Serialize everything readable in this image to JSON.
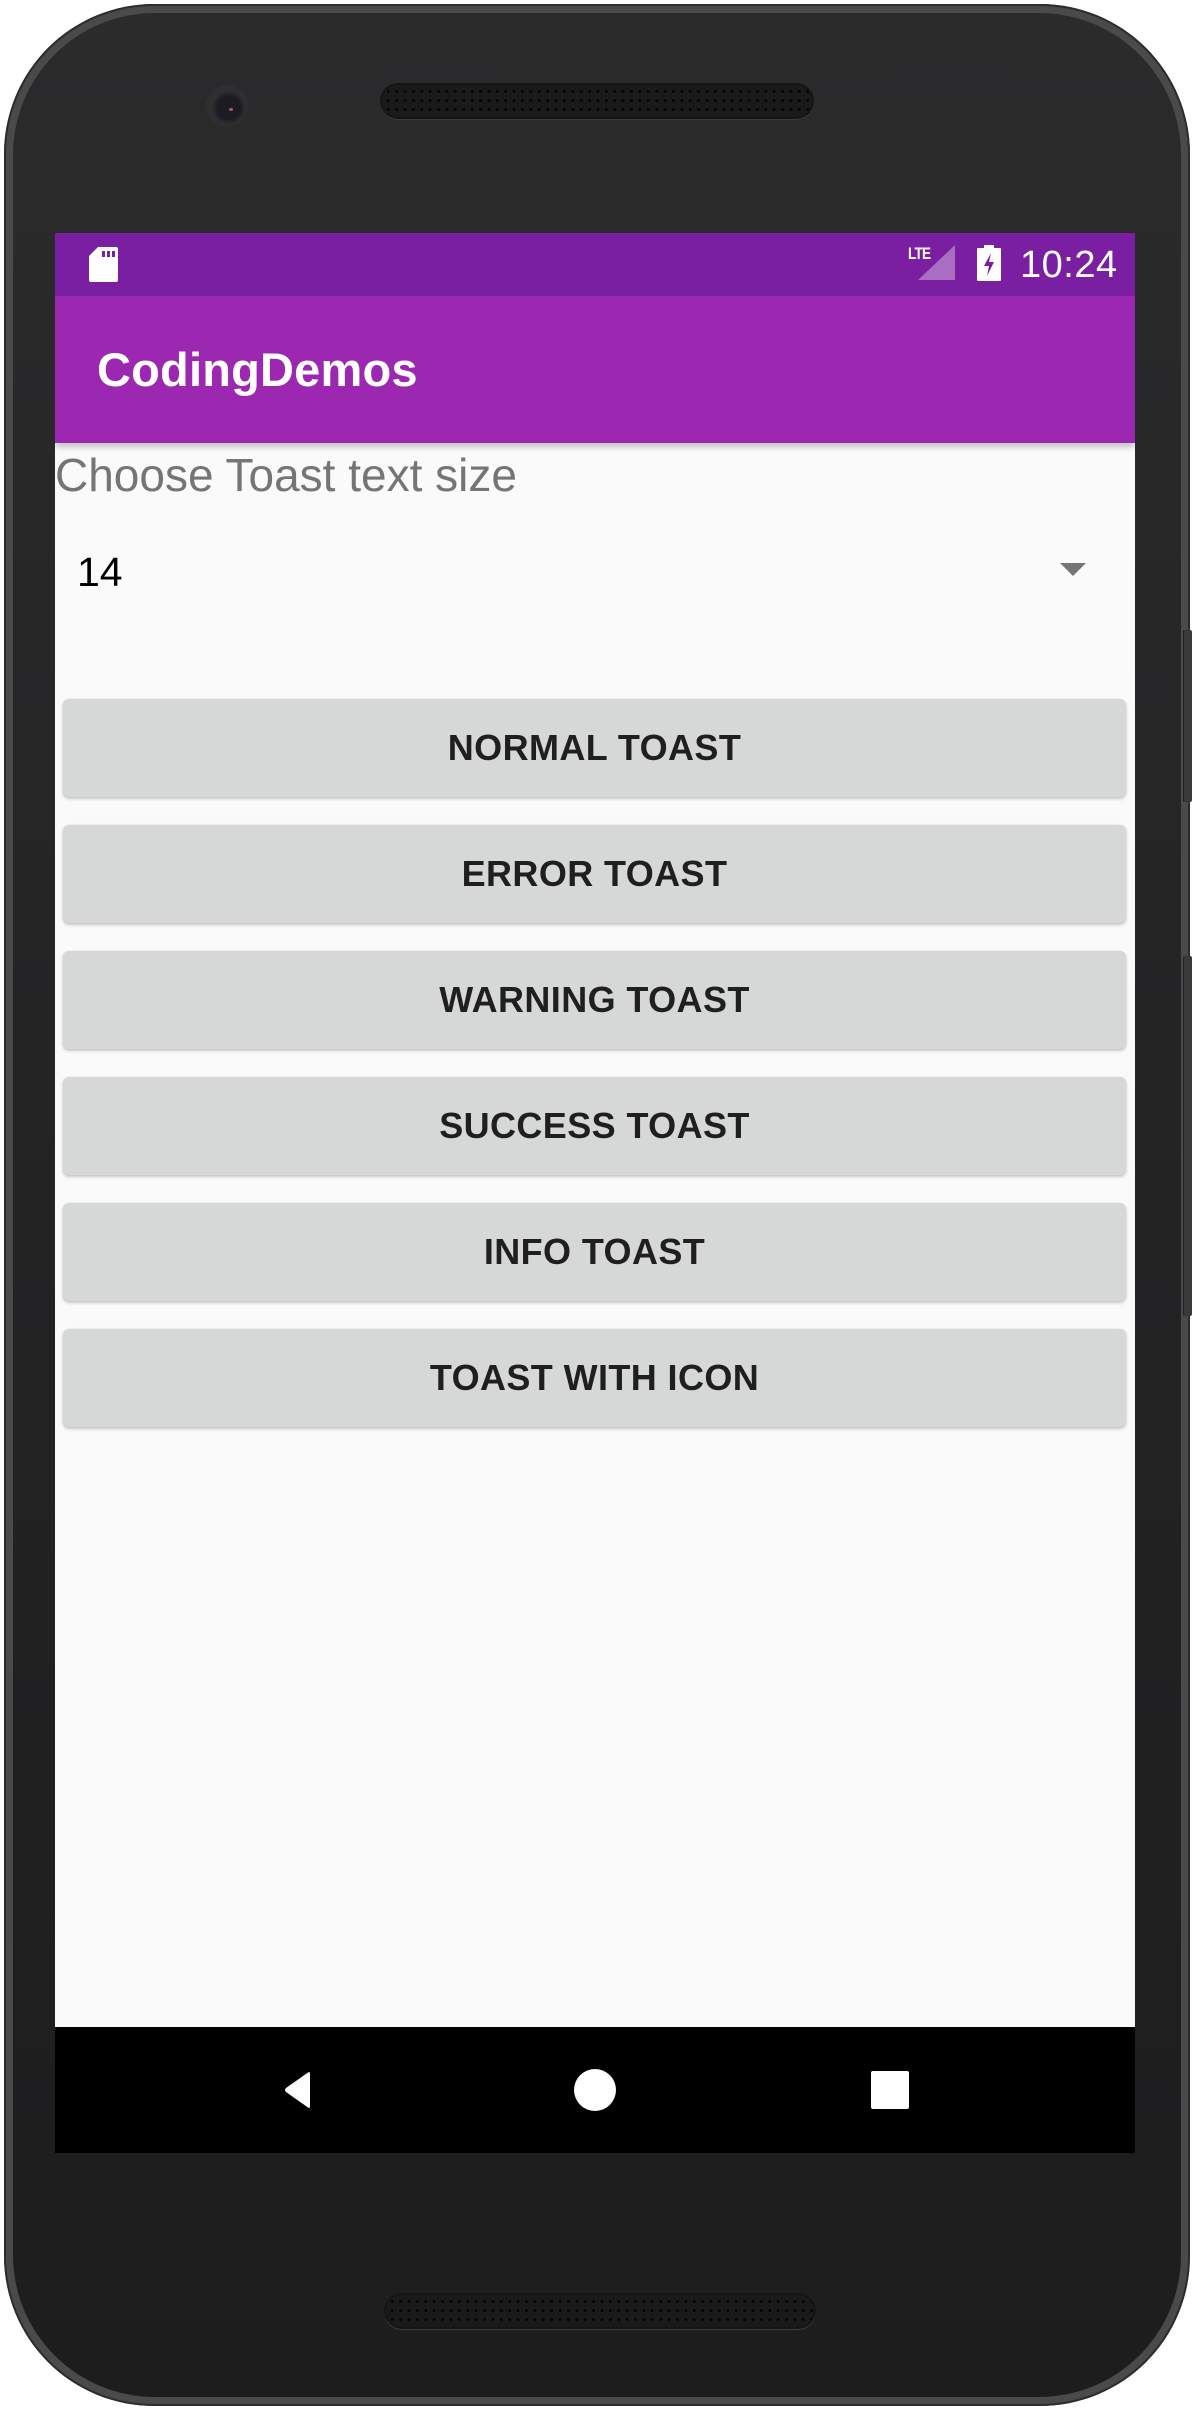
{
  "status_bar": {
    "left_icons": [
      "sd-card-icon"
    ],
    "network_label": "LTE",
    "right_icons": [
      "signal-icon",
      "battery-charging-icon"
    ],
    "time": "10:24"
  },
  "toolbar": {
    "title": "CodingDemos"
  },
  "main": {
    "spinner_label": "Choose Toast text size",
    "spinner": {
      "selected_value": "14",
      "icon": "dropdown-arrow-icon"
    },
    "buttons": [
      {
        "label": "NORMAL TOAST"
      },
      {
        "label": "ERROR TOAST"
      },
      {
        "label": "WARNING TOAST"
      },
      {
        "label": "SUCCESS TOAST"
      },
      {
        "label": "INFO TOAST"
      },
      {
        "label": "TOAST WITH ICON"
      }
    ]
  },
  "nav_bar": {
    "buttons": [
      "back-icon",
      "home-icon",
      "recents-icon"
    ]
  },
  "colors": {
    "status_bar": "#7b1fa2",
    "toolbar": "#9c27b0",
    "background": "#fafafa",
    "button": "#d6d7d7",
    "button_text": "#1f1f1f",
    "label_text": "#757575"
  }
}
